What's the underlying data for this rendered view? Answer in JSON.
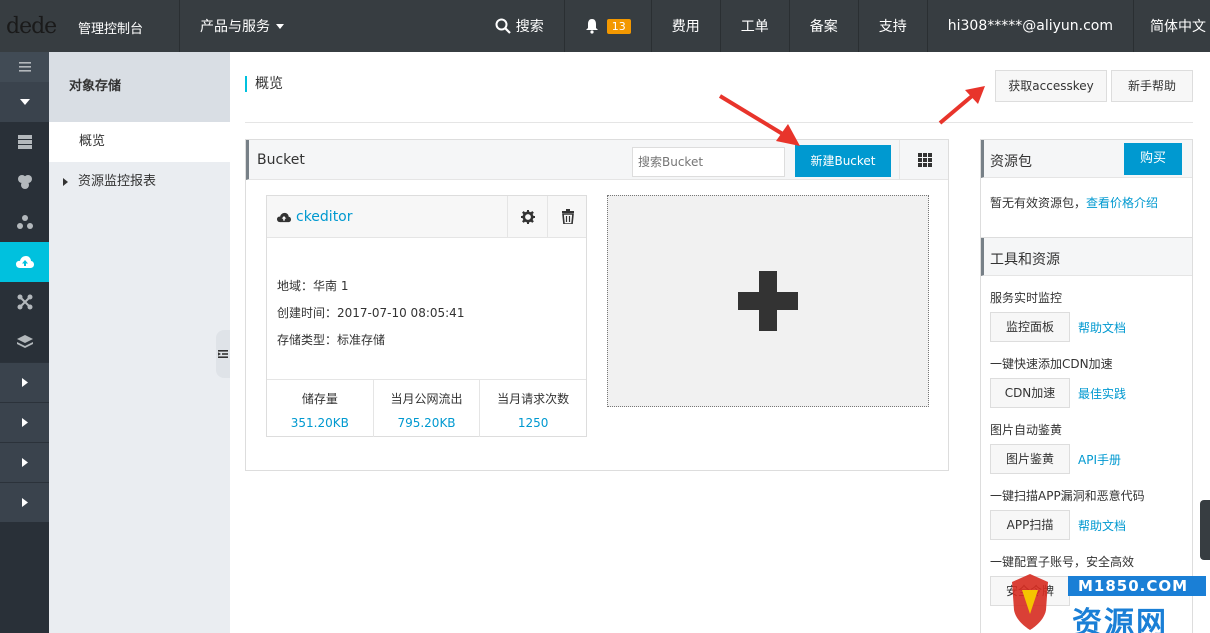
{
  "topbar": {
    "logo": "dede",
    "console": "管理控制台",
    "products": "产品与服务",
    "search": "搜索",
    "notif_count": "13",
    "fees": "费用",
    "ticket": "工单",
    "record": "备案",
    "support": "支持",
    "account": "hi308*****@aliyun.com",
    "language": "简体中文"
  },
  "sidebar": {
    "title": "对象存储",
    "items": [
      {
        "label": "概览"
      },
      {
        "label": "资源监控报表"
      }
    ]
  },
  "main": {
    "page_title": "概览",
    "get_accesskey": "获取accesskey",
    "newbie_help": "新手帮助",
    "bucket_panel": {
      "title": "Bucket",
      "search_placeholder": "搜索Bucket",
      "new_bucket": "新建Bucket"
    },
    "bucket": {
      "name": "ckeditor",
      "region": "地域：华南 1",
      "created": "创建时间：2017-07-10 08:05:41",
      "storage_type": "存储类型：标准存储",
      "stats": [
        {
          "label": "储存量",
          "value": "351.20KB"
        },
        {
          "label": "当月公网流出",
          "value": "795.20KB"
        },
        {
          "label": "当月请求次数",
          "value": "1250"
        }
      ]
    }
  },
  "right": {
    "resource_pack": {
      "title": "资源包",
      "buy": "购买",
      "empty": "暂无有效资源包，",
      "price_link": "查看价格介绍"
    },
    "tools": {
      "title": "工具和资源",
      "items": [
        {
          "label": "服务实时监控",
          "button": "监控面板",
          "link": "帮助文档"
        },
        {
          "label": "一键快速添加CDN加速",
          "button": "CDN加速",
          "link": "最佳实践"
        },
        {
          "label": "图片自动鉴黄",
          "button": "图片鉴黄",
          "link": "API手册"
        },
        {
          "label": "一键扫描APP漏洞和恶意代码",
          "button": "APP扫描",
          "link": "帮助文档"
        },
        {
          "label": "一键配置子账号，安全高效",
          "button": "安全令牌",
          "link": ""
        }
      ]
    }
  },
  "watermark": {
    "site": "M1850.COM",
    "text": "资源网"
  },
  "colors": {
    "topbar": "#373d41",
    "rail": "#293038",
    "accent": "#00c1de",
    "primary": "#0099d0",
    "arrow": "#e8342b"
  }
}
